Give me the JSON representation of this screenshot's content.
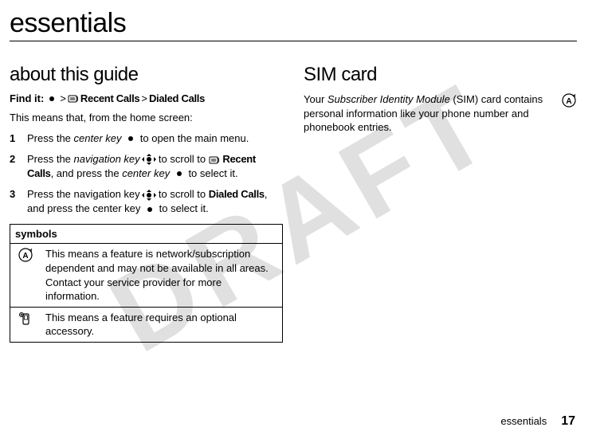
{
  "watermark": "DRAFT",
  "page_title": "essentials",
  "left": {
    "section_head": "about this guide",
    "find_it_label": "Find it:",
    "gt": ">",
    "recent_calls": "Recent Calls",
    "dialed_calls": "Dialed Calls",
    "intro": "This means that, from the home screen:",
    "steps": [
      {
        "num": "1",
        "pre": "Press the ",
        "italic": "center key",
        "post": " to open the main menu."
      },
      {
        "num": "2",
        "pre": "Press the ",
        "italic": "navigation key",
        "mid1": " to scroll to ",
        "bold1": "Recent Calls",
        "mid2": ", and press the ",
        "italic2": "center key",
        "post": " to select it."
      },
      {
        "num": "3",
        "pre": "Press the navigation key ",
        "mid1": " to scroll to ",
        "bold1": "Dialed Calls",
        "mid2": ", and press the center key ",
        "post": " to select it."
      }
    ],
    "symbols_header": "symbols",
    "sym_network": "This means a feature is network/subscription dependent and may not be available in all areas. Contact your service provider for more information.",
    "sym_accessory": "This means a feature requires an optional accessory."
  },
  "right": {
    "section_head": "SIM card",
    "body_pre": "Your ",
    "body_italic": "Subscriber Identity Module",
    "body_post": " (SIM) card contains personal information like your phone number and phonebook entries."
  },
  "footer": {
    "section": "essentials",
    "page": "17"
  },
  "chart_data": null
}
